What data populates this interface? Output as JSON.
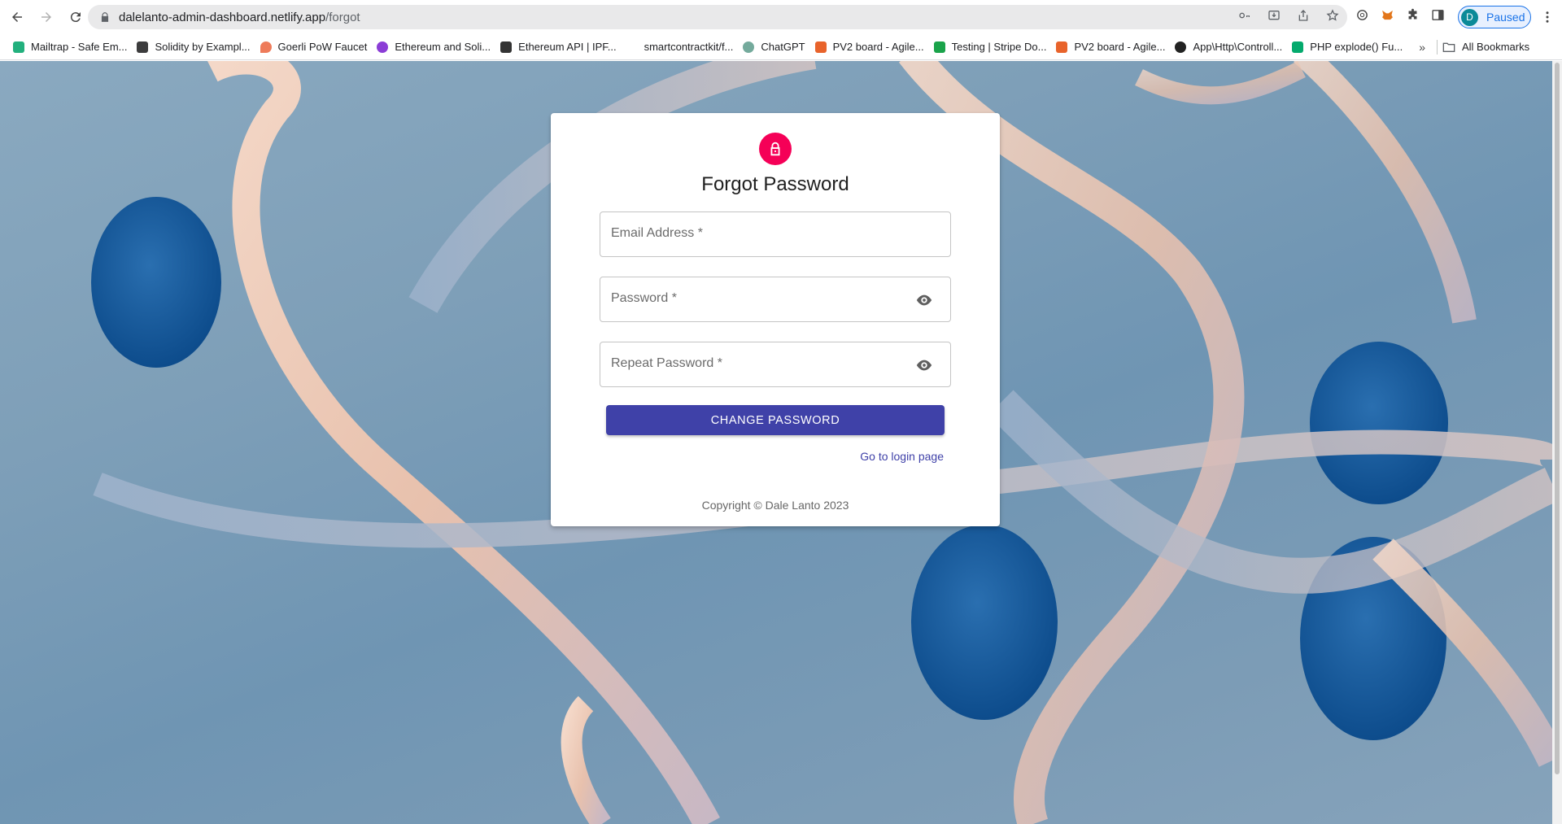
{
  "browser": {
    "url_host": "dalelanto-admin-dashboard.netlify.app",
    "url_path": "/forgot",
    "profile_initial": "D",
    "profile_status": "Paused",
    "bookmarks": [
      {
        "label": "Mailtrap - Safe Em...",
        "color": "#22b07d"
      },
      {
        "label": "Solidity by Exampl...",
        "color": "#3c3c3d"
      },
      {
        "label": "Goerli PoW Faucet",
        "color": "#ee7b5a"
      },
      {
        "label": "Ethereum and Soli...",
        "color": "#8b3dd6"
      },
      {
        "label": "Ethereum API | IPF...",
        "color": "#333333"
      },
      {
        "label": "smartcontractkit/f...",
        "color": "#ffffff"
      },
      {
        "label": "ChatGPT",
        "color": "#74aa9c"
      },
      {
        "label": "PV2 board - Agile...",
        "color": "#e8632b"
      },
      {
        "label": "Testing | Stripe Do...",
        "color": "#1aa34a"
      },
      {
        "label": "PV2 board - Agile...",
        "color": "#e8632b"
      },
      {
        "label": "App\\Http\\Controll...",
        "color": "#222222"
      },
      {
        "label": "PHP explode() Fu...",
        "color": "#04aa6d"
      }
    ],
    "more": "»",
    "all_bookmarks": "All Bookmarks"
  },
  "form": {
    "title": "Forgot Password",
    "email_label": "Email Address *",
    "password_label": "Password *",
    "repeat_password_label": "Repeat Password *",
    "submit_label": "CHANGE PASSWORD",
    "login_link": "Go to login page",
    "copyright": "Copyright © Dale Lanto 2023"
  },
  "colors": {
    "accent": "#3f41a8",
    "lock_avatar": "#f50057"
  }
}
